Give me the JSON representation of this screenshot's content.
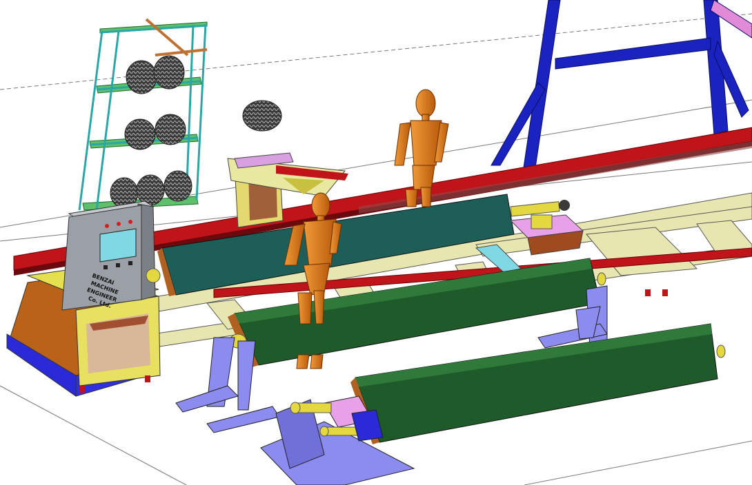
{
  "control_panel": {
    "label_line1": "BENZAI",
    "label_line2": "MACHINE",
    "label_line3": "ENGINEER",
    "label_line4": "Co. Ltd."
  },
  "colors": {
    "background": "#ffffff",
    "rail_red": "#c0141b",
    "frame_beige": "#e8e6b0",
    "frame_yellow": "#e4d870",
    "beam_teal": "#1d5e58",
    "beam_green": "#1f5a2a",
    "stand_lavender": "#8c8cf0",
    "gantry_blue": "#1a23c0",
    "shelf_teal": "#2aa6a6",
    "shelf_green": "#5ec06a",
    "mannequin_orange": "#e07a18",
    "cabinet_grey": "#9aa0a6",
    "screen_cyan": "#7fd8e4",
    "pink_block": "#e8a0e8"
  }
}
